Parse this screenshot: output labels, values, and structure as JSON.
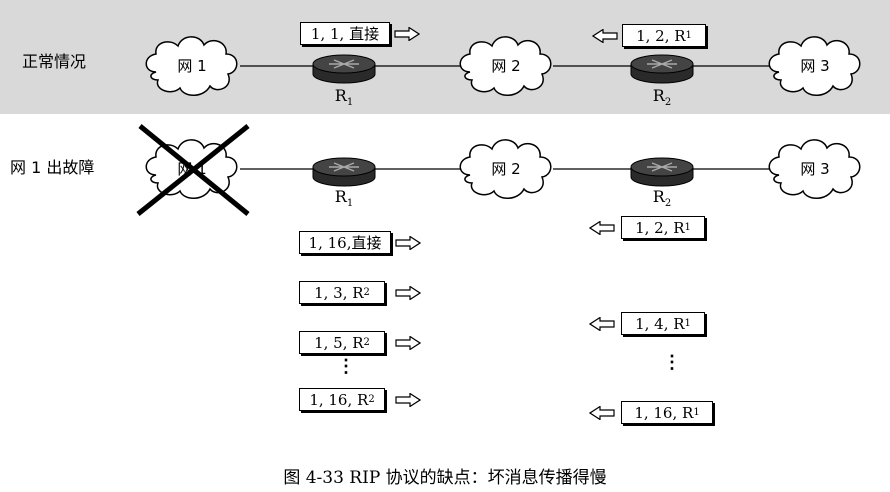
{
  "row_labels": {
    "normal": "正常情况",
    "fault": "网 1 出故障"
  },
  "networks": {
    "net1": "网 1",
    "net2": "网 2",
    "net3": "网 3"
  },
  "routers": {
    "r1": "R",
    "r1_sub": "1",
    "r2": "R",
    "r2_sub": "2"
  },
  "normal_messages": {
    "r1_update": "1, 1, 直接",
    "r2_update_main": "1, 2, R",
    "r2_update_sub": "1"
  },
  "fault_r1_messages": [
    {
      "main": "1, 16,直接",
      "sub": ""
    },
    {
      "main": "1, 3, R",
      "sub": "2"
    },
    {
      "main": "1, 5, R",
      "sub": "2"
    },
    {
      "main": "1, 16, R",
      "sub": "2"
    }
  ],
  "fault_r2_messages": [
    {
      "main": "1, 2, R",
      "sub": "1"
    },
    {
      "main": "1, 4, R",
      "sub": "1"
    },
    {
      "main": "1, 16, R",
      "sub": "1"
    }
  ],
  "ellipsis": "⋮",
  "caption": "图 4-33   RIP 协议的缺点：坏消息传播得慢"
}
